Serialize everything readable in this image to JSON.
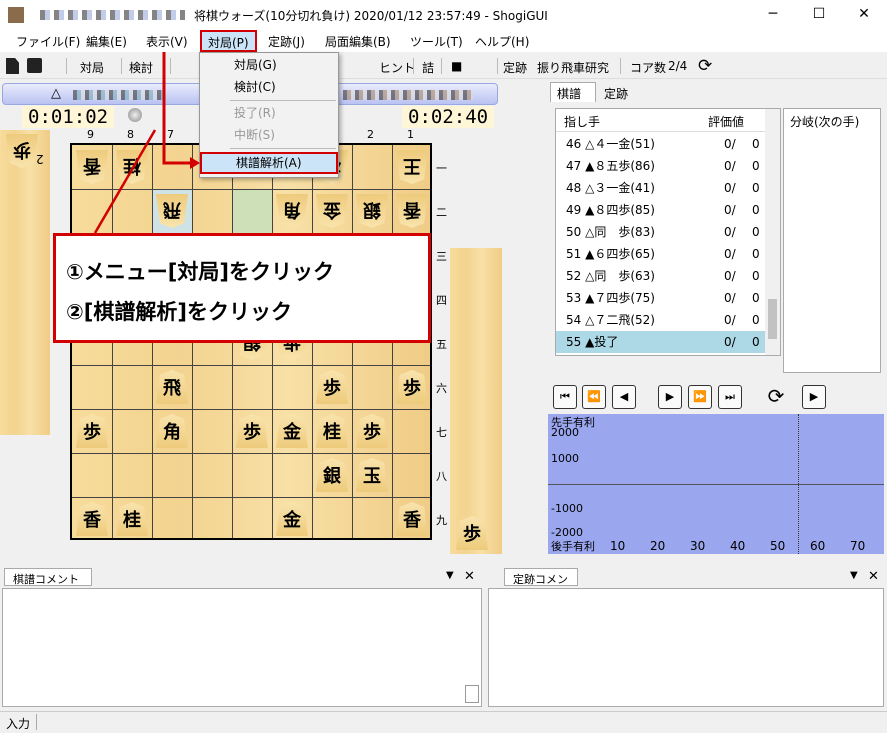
{
  "window": {
    "title": "将棋ウォーズ(10分切れ負け) 2020/01/12 23:57:49 - ShogiGUI"
  },
  "menu": {
    "items": [
      "ファイル(F)",
      "編集(E)",
      "表示(V)",
      "対局(P)",
      "定跡(J)",
      "局面編集(B)",
      "ツール(T)",
      "ヘルプ(H)"
    ]
  },
  "toolbar": {
    "taikyoku": "対局",
    "kento": "検討",
    "hint": "ヒント",
    "tsume": "詰",
    "stop": "■",
    "joseki": "定跡",
    "joseki_name": "振り飛車研究",
    "core_label": "コア数",
    "core_value": "2/4"
  },
  "clocks": {
    "left": "0:01:02",
    "right": "0:02:40"
  },
  "player_mark": "△",
  "dropdown": {
    "items": [
      {
        "label": "対局(G)",
        "enabled": true
      },
      {
        "label": "検討(C)",
        "enabled": true
      },
      {
        "label": "投了(R)",
        "enabled": false
      },
      {
        "label": "中断(S)",
        "enabled": false
      },
      {
        "label": "棋譜解析(A)",
        "enabled": true
      }
    ]
  },
  "annotation": {
    "line1": "①メニュー[対局]をクリック",
    "line2": "②[棋譜解析]をクリック"
  },
  "board": {
    "col_labels": [
      "9",
      "8",
      "7",
      "1",
      "2",
      "1"
    ],
    "row_labels": [
      "一",
      "二",
      "三",
      "四",
      "五",
      "六",
      "七",
      "八",
      "九"
    ]
  },
  "right_panel": {
    "tabs": [
      "棋譜",
      "定跡"
    ],
    "move_header": "指し手",
    "eval_header": "評価値",
    "branch_header": "分岐(次の手)",
    "moves": [
      {
        "text": "46 △４一金(51)",
        "eval": "0/",
        "val": "0"
      },
      {
        "text": "47 ▲８五歩(86)",
        "eval": "0/",
        "val": "0"
      },
      {
        "text": "48 △３一金(41)",
        "eval": "0/",
        "val": "0"
      },
      {
        "text": "49 ▲８四歩(85)",
        "eval": "0/",
        "val": "0"
      },
      {
        "text": "50 △同　歩(83)",
        "eval": "0/",
        "val": "0"
      },
      {
        "text": "51 ▲６四歩(65)",
        "eval": "0/",
        "val": "0"
      },
      {
        "text": "52 △同　歩(63)",
        "eval": "0/",
        "val": "0"
      },
      {
        "text": "53 ▲７四歩(75)",
        "eval": "0/",
        "val": "0"
      },
      {
        "text": "54 △７二飛(52)",
        "eval": "0/",
        "val": "0"
      },
      {
        "text": "55 ▲投了",
        "eval": "0/",
        "val": "0"
      }
    ]
  },
  "graph": {
    "top_label": "先手有利",
    "bottom_label": "後手有利",
    "y_ticks": [
      "2000",
      "1000",
      "-1000",
      "-2000"
    ],
    "x_ticks": [
      "10",
      "20",
      "30",
      "40",
      "50",
      "60",
      "70"
    ]
  },
  "bottom": {
    "comment_tab": "棋譜コメント",
    "joseki_comment_tab": "定跡コメント"
  },
  "status": {
    "text": "入力"
  }
}
